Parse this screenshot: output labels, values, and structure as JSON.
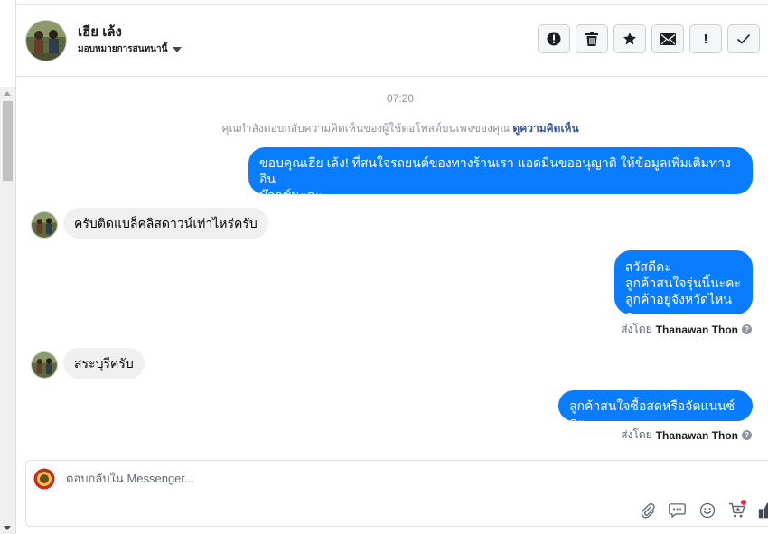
{
  "header": {
    "contact_name": "เฮีย เล้ง",
    "assign_label": "มอบหมายการสนทนานี้"
  },
  "toolbar": {
    "buttons": [
      {
        "icon": "alert-circle-icon"
      },
      {
        "icon": "trash-icon"
      },
      {
        "icon": "star-icon"
      },
      {
        "icon": "envelope-icon"
      },
      {
        "icon": "exclamation-icon",
        "text": "!"
      },
      {
        "icon": "check-icon"
      }
    ]
  },
  "conversation": {
    "timestamp": "07:20",
    "reply_notice": {
      "text": "คุณกำลังตอบกลับความคิดเห็นของผู้ใช้ต่อโพสต์บนเพจของคุณ",
      "link": "ดูความคิดเห็น"
    },
    "messages": [
      {
        "direction": "out",
        "lines": [
          "ขอบคุณเฮีย เล้ง! ที่สนใจรถยนต์ของทางร้านเรา แอดมินขออนุญาติ ให้ข้อมูลเพิ่มเติมทางอิน",
          "บ๊อกซ์นะคะ"
        ]
      },
      {
        "direction": "in",
        "lines": [
          "ครับติดแบล็คลิสดาวน์เท่าไหร่ครับ"
        ]
      },
      {
        "direction": "out",
        "lines": [
          "สวัสดีคะ",
          "ลูกค้าสนใจรุ่นนี้นะคะ",
          "ลูกค้าอยู่จังหวัดไหนคะ"
        ],
        "sent_by_label": "ส่งโดย",
        "sent_by_name": "Thanawan Thon"
      },
      {
        "direction": "in",
        "lines": [
          "สระบุรีครับ"
        ]
      },
      {
        "direction": "out",
        "lines": [
          "ลูกค้าสนใจซื้อสดหรือจัดแนนซ์คะ"
        ],
        "sent_by_label": "ส่งโดย",
        "sent_by_name": "Thanawan Thon"
      }
    ]
  },
  "composer": {
    "placeholder": "ตอบกลับใน Messenger...",
    "value": "",
    "tools": [
      "paperclip-icon",
      "saved-reply-icon",
      "emoji-icon",
      "cart-icon",
      "like-icon"
    ]
  },
  "colors": {
    "outgoing_bubble": "#0a7cff",
    "incoming_bubble": "#f0f0f0",
    "link": "#365899"
  }
}
